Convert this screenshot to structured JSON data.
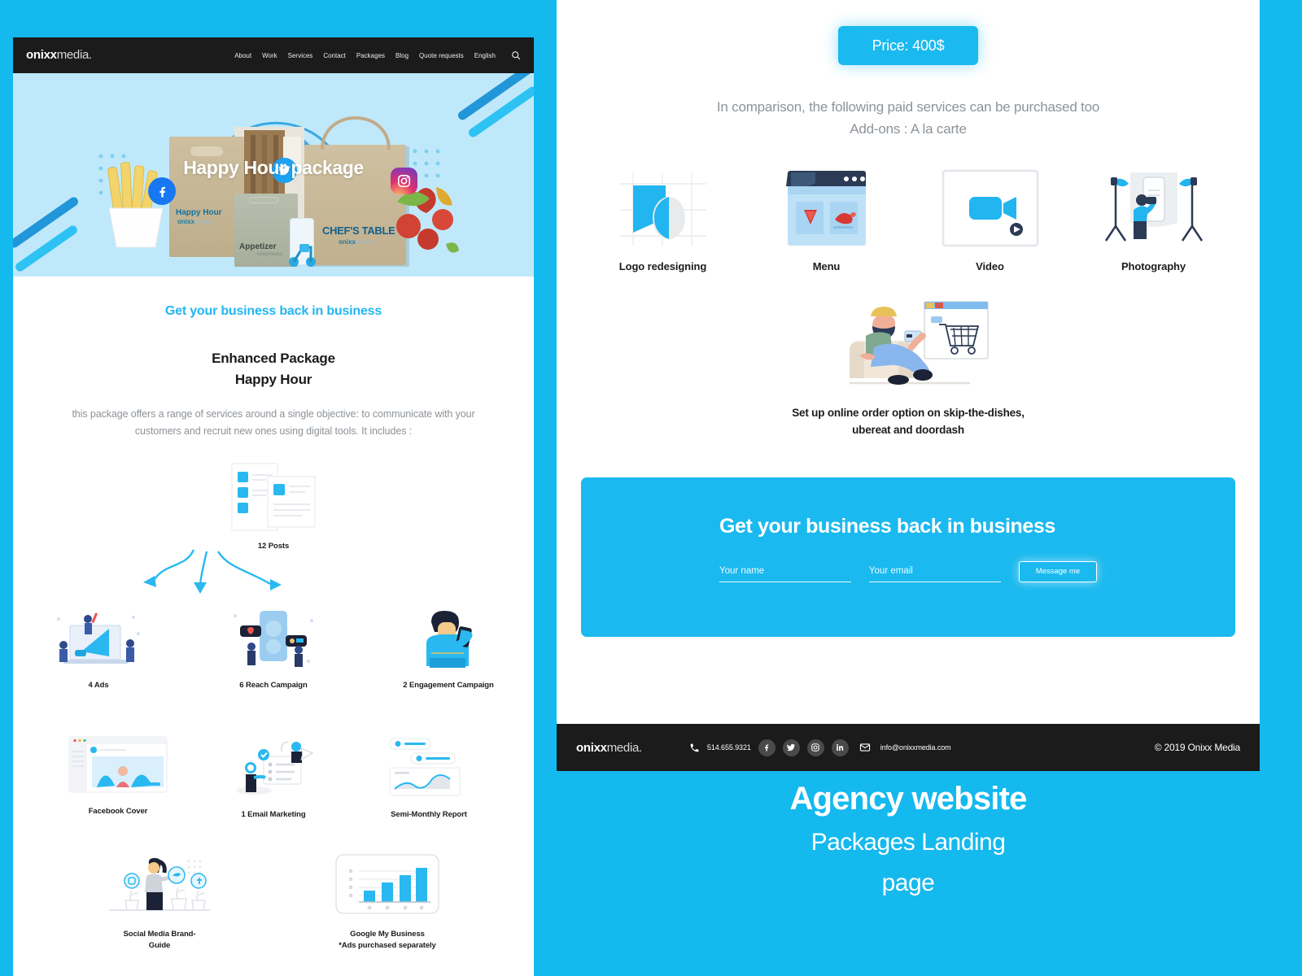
{
  "brand": {
    "part1": "onixx",
    "part2": "media.",
    "accent": "#1ab9ef",
    "dark": "#1b1b1b",
    "page_bg": "#14b9ee",
    "hero_bg": "#bfe9fb"
  },
  "nav": {
    "items": [
      {
        "label": "About"
      },
      {
        "label": "Work"
      },
      {
        "label": "Services"
      },
      {
        "label": "Contact"
      },
      {
        "label": "Packages"
      },
      {
        "label": "Blog"
      },
      {
        "label": "Quote requests"
      },
      {
        "label": "English"
      }
    ],
    "search_icon": "search-icon"
  },
  "hero": {
    "title": "Happy Hour package",
    "social": [
      "facebook",
      "twitter",
      "instagram"
    ]
  },
  "intro": {
    "kicker": "Get your business back in business",
    "title_line1": "Enhanced Package",
    "title_line2": "Happy Hour",
    "description": "this package offers a range of services around a single objective: to communicate with your customers and recruit new ones using digital tools. It includes :"
  },
  "hub": {
    "root_label": "12 Posts",
    "children": [
      {
        "label": "4 Ads"
      },
      {
        "label": "6 Reach Campaign"
      },
      {
        "label": "2 Engagement Campaign"
      }
    ]
  },
  "deliverables_row1": [
    {
      "label": "Facebook Cover"
    },
    {
      "label": "1 Email Marketing"
    },
    {
      "label": "Semi-Monthly Report"
    }
  ],
  "deliverables_row2": [
    {
      "label_line1": "Social Media Brand-",
      "label_line2": "Guide"
    },
    {
      "label_line1": "Google My Business",
      "label_line2": "*Ads purchased separately"
    }
  ],
  "price": {
    "label": "Price: 400$"
  },
  "addons_intro": {
    "line1": "In comparison, the following paid services can be purchased too",
    "line2": "Add-ons : A la carte"
  },
  "addons": [
    {
      "label": "Logo redesigning",
      "icon": "logo-design-icon"
    },
    {
      "label": "Menu",
      "icon": "menu-browser-icon"
    },
    {
      "label": "Video",
      "icon": "video-camera-icon"
    },
    {
      "label": "Photography",
      "icon": "photo-studio-icon"
    }
  ],
  "online_order": {
    "caption_line1": "Set up online order option on skip-the-dishes,",
    "caption_line2": "ubereat and doordash",
    "icon": "online-shopping-icon"
  },
  "cta": {
    "title": "Get your business back in business",
    "name_placeholder": "Your name",
    "name_value": "",
    "email_placeholder": "Your email",
    "email_value": "",
    "button_label": "Message me"
  },
  "footer": {
    "phone": "514.655.9321",
    "email": "info@onixxmedia.com",
    "copyright": "© 2019 Onixx Media",
    "socials": [
      "facebook-icon",
      "twitter-icon",
      "instagram-icon",
      "linkedin-icon"
    ]
  },
  "caption": {
    "line1": "Agency website",
    "line2": "Packages Landing",
    "line3": "page"
  }
}
